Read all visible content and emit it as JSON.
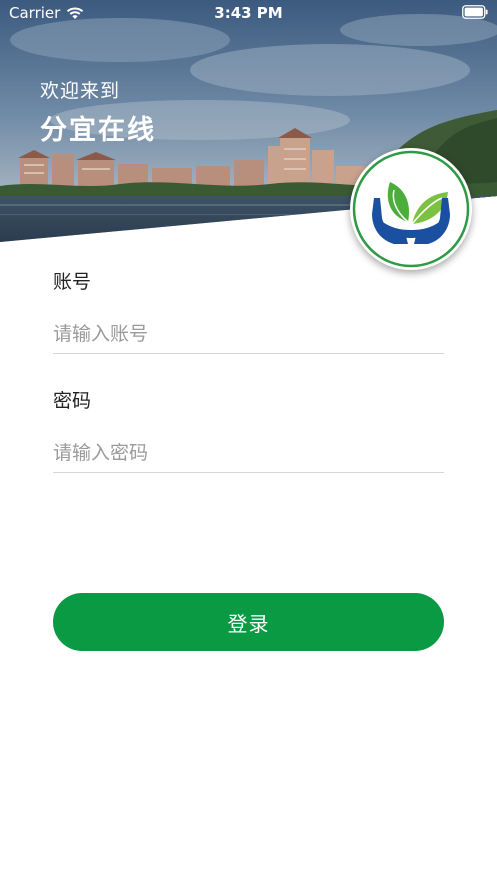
{
  "status_bar": {
    "carrier": "Carrier",
    "time": "3:43 PM",
    "wifi_icon": "wifi-icon",
    "battery_icon": "battery-icon"
  },
  "header": {
    "welcome": "欢迎来到",
    "app_name": "分宜在线",
    "logo_icon": "hands-leaf-logo-icon"
  },
  "form": {
    "account": {
      "label": "账号",
      "value": "",
      "placeholder": "请输入账号"
    },
    "password": {
      "label": "密码",
      "value": "",
      "placeholder": "请输入密码"
    },
    "login_label": "登录"
  },
  "colors": {
    "accent": "#0a9a43",
    "logo_hands": "#1b4fa0",
    "logo_leaf": "#4cae3a"
  }
}
